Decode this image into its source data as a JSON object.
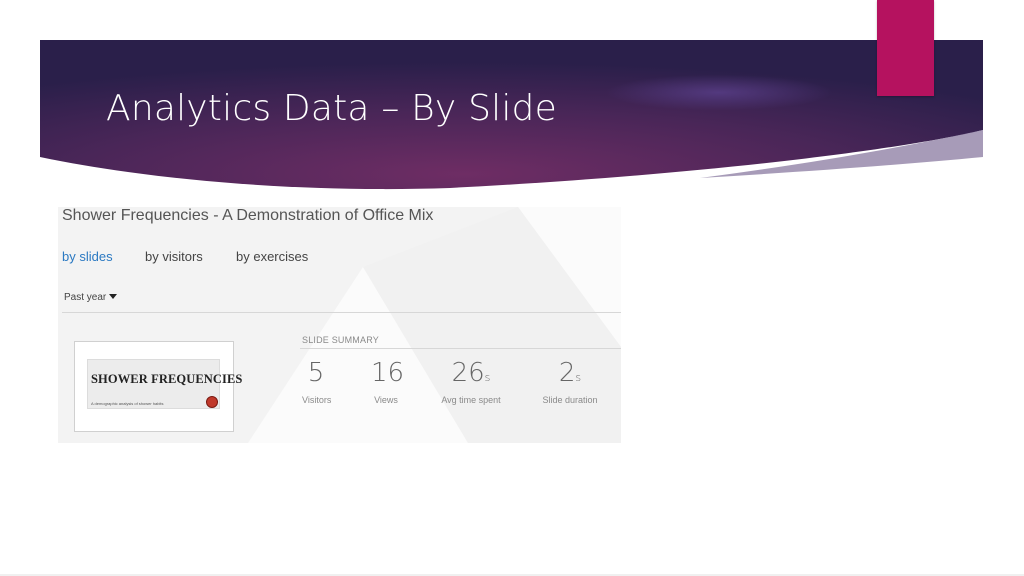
{
  "slide": {
    "title": "Analytics Data – By Slide"
  },
  "colors": {
    "banner_dark": "#2b1f4d",
    "banner_mid": "#5b2b66",
    "accent": "#b5125f",
    "link_active": "#2b79c2"
  },
  "report": {
    "title": "Shower Frequencies - A Demonstration of Office Mix",
    "tabs": [
      {
        "label": "by slides",
        "active": true
      },
      {
        "label": "by visitors",
        "active": false
      },
      {
        "label": "by exercises",
        "active": false
      }
    ],
    "period": "Past year",
    "thumbnail": {
      "title": "SHOWER FREQUENCIES",
      "subtitle": "A demographic analysis of shower habits"
    },
    "summary_label": "SLIDE SUMMARY",
    "stats": [
      {
        "value": "5",
        "unit": "",
        "label": "Visitors"
      },
      {
        "value": "16",
        "unit": "",
        "label": "Views"
      },
      {
        "value": "26",
        "unit": "s",
        "label": "Avg time spent"
      },
      {
        "value": "2",
        "unit": "s",
        "label": "Slide duration"
      }
    ]
  }
}
